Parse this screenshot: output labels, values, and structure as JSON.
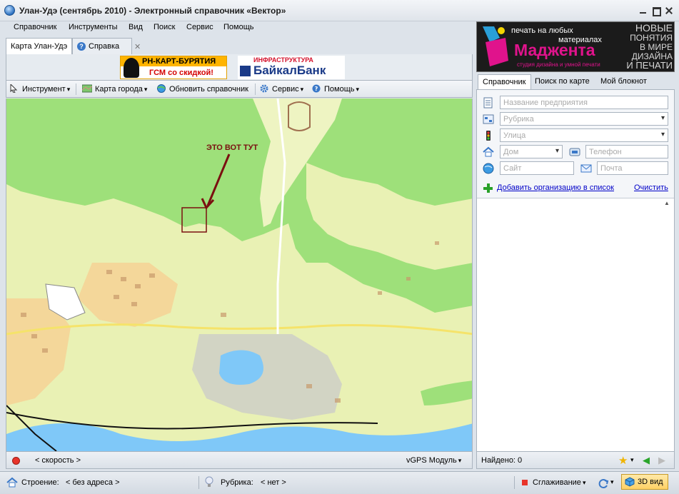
{
  "window": {
    "title": "Улан-Удэ (сентябрь 2010) - Электронный справочник «Вектор»"
  },
  "menu": [
    "Справочник",
    "Инструменты",
    "Вид",
    "Поиск",
    "Сервис",
    "Помощь"
  ],
  "tabs": [
    {
      "label": "Карта Улан-Удэ",
      "active": true
    },
    {
      "label": "Справка",
      "active": false
    }
  ],
  "banners": {
    "rn": {
      "line1": "РН-КАРТ-БУРЯТИЯ",
      "line2": "ГСМ со скидкой!"
    },
    "baikal": {
      "line1": "ИНФРАСТРУКТУРА",
      "line2": "БайкалБанк"
    }
  },
  "toolbar": {
    "tool": "Инструмент",
    "city_map": "Карта города",
    "update": "Обновить справочник",
    "service": "Сервис",
    "help": "Помощь"
  },
  "map": {
    "annotation": "ЭТО ВОТ ТУТ",
    "colors": {
      "forest": "#9ee07a",
      "urban": "#e9f1b4",
      "water": "#7fc8f8",
      "industrial": "#c9c9c9"
    }
  },
  "map_status": {
    "speed": "< скорость >",
    "gps": "vGPS Модуль"
  },
  "side_banner": {
    "line1": "печать на любых",
    "line2": "материалах",
    "name": "Маджента",
    "sub": "студия дизайна и умной печати",
    "right": [
      "НОВЫЕ",
      "ПОНЯТИЯ",
      "В МИРЕ",
      "ДИЗАЙНА",
      "И ПЕЧАТИ"
    ]
  },
  "right_tabs": [
    {
      "label": "Справочник",
      "active": true
    },
    {
      "label": "Поиск по карте",
      "active": false
    },
    {
      "label": "Мой блокнот",
      "active": false
    }
  ],
  "search": {
    "name_placeholder": "Название предприятия",
    "rubric_placeholder": "Рубрика",
    "street_placeholder": "Улица",
    "house_placeholder": "Дом",
    "phone_placeholder": "Телефон",
    "site_placeholder": "Сайт",
    "mail_placeholder": "Почта",
    "add_link": "Добавить организацию в список",
    "clear_link": "Очистить"
  },
  "results": {
    "found": "Найдено: 0"
  },
  "bottom": {
    "building_label": "Строение:",
    "building_value": "< без адреса >",
    "rubric_label": "Рубрика:",
    "rubric_value": "< нет >",
    "smoothing": "Сглаживание",
    "view3d": "3D вид"
  }
}
